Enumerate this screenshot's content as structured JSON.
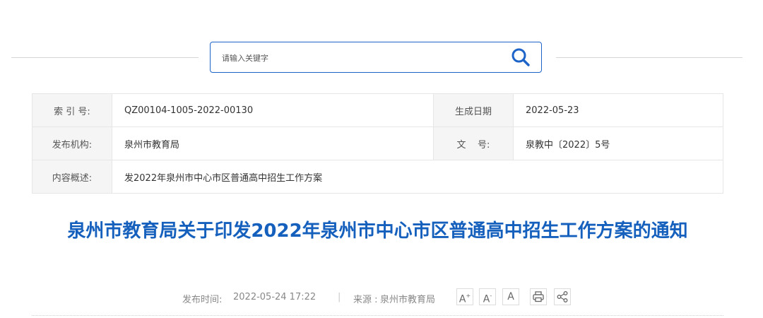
{
  "search": {
    "placeholder": "请输入关键字"
  },
  "info": {
    "index_label": "索 引 号:",
    "index_value": "QZ00104-1005-2022-00130",
    "date_label": "生成日期",
    "date_value": "2022-05-23",
    "org_label": "发布机构:",
    "org_value": "泉州市教育局",
    "docno_label": "文    号:",
    "docno_value": "泉教中〔2022〕5号",
    "summary_label": "内容概述:",
    "summary_value": "发2022年泉州市中心市区普通高中招生工作方案"
  },
  "article": {
    "title": "泉州市教育局关于印发2022年泉州市中心市区普通高中招生工作方案的通知"
  },
  "meta": {
    "publish_label": "发布时间:",
    "publish_time": "2022-05-24 17:22",
    "separator": "|",
    "source_label": "来源 :",
    "source_value": "泉州市教育局"
  },
  "toolbar": {
    "font_increase": "A",
    "font_increase_mark": "+",
    "font_decrease": "A",
    "font_decrease_mark": "-",
    "font_default": "A"
  },
  "colors": {
    "accent": "#1e64c8",
    "title": "#1560bd",
    "label_bg": "#f5f5f5"
  },
  "icons": [
    "search-icon",
    "print-icon",
    "share-icon"
  ]
}
